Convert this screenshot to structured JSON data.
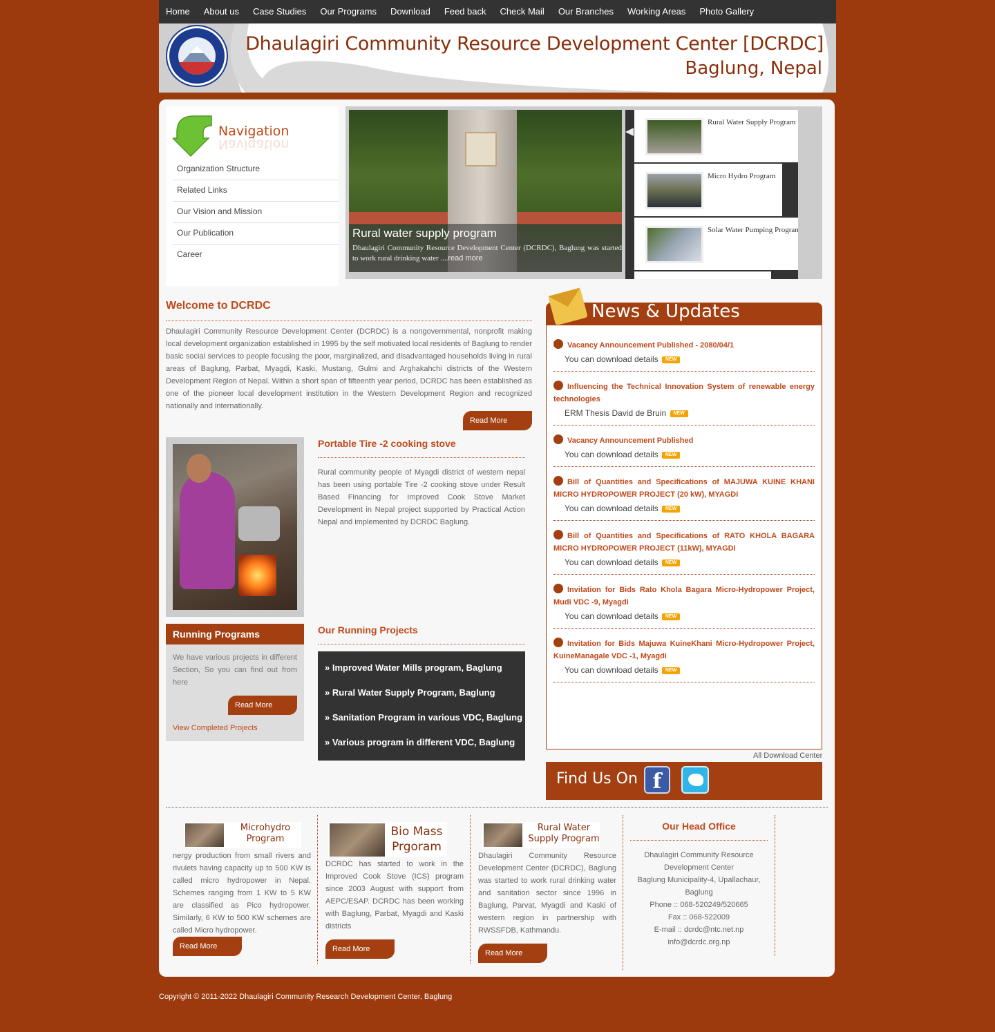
{
  "topnav": [
    "Home",
    "About us",
    "Case Studies",
    "Our Programs",
    "Download",
    "Feed back",
    "Check Mail",
    "Our Branches",
    "Working Areas",
    "Photo Gallery"
  ],
  "banner": {
    "title_line1": "Dhaulagiri Community Resource Development Center [DCRDC]",
    "title_line2": "Baglung, Nepal"
  },
  "navigation": {
    "heading": "Navigation",
    "items": [
      "Organization Structure",
      "Related Links",
      "Our Vision and Mission",
      "Our Publication",
      "Career"
    ]
  },
  "slider": {
    "main_title": "Rural water supply program",
    "main_text": "Dhaulagiri Community Resource Development Center (DCRDC), Baglung was started to work rural drinking water ....",
    "read_more": "read more",
    "thumbs": [
      "Rural Water Supply Program",
      "Micro Hydro Program",
      "Solar Water Pumping Program"
    ]
  },
  "welcome": {
    "title": "Welcome to DCRDC",
    "text": "Dhaulagiri Community Resource Development Center (DCRDC) is a nongovernmental, nonprofit making local development organization established in 1995 by the self motivated local residents of Baglung to render basic social services to people focusing the poor, marginalized, and disadvantaged households living in rural areas of Baglung, Parbat, Myagdi, Kaski, Mustang, Gulmi and Arghakahchi districts of the Western Development Region of Nepal. Within a short span of fifteenth year period, DCRDC has been established as one of the pioneer local development institution in the Western Development Region and recognized nationally and internationally.",
    "read_more": "Read More"
  },
  "stove": {
    "title": "Portable Tire -2 cooking stove",
    "text": "Rural community people of Myagdi district of western nepal has been using portable Tire -2 cooking stove under Result Based Financing for Improved Cook Stove Market Development in Nepal project supported by Practical Action Nepal and implemented by DCRDC Baglung."
  },
  "running": {
    "title": "Running Programs",
    "text": "We have various projects in different Section, So you can find out from here",
    "read_more": "Read More",
    "completed_link": "View Completed Projects"
  },
  "projects": {
    "title": "Our Running Projects",
    "items": [
      "» Improved Water Mills program, Baglung",
      "» Rural Water Supply Program, Baglung",
      "» Sanitation Program in various VDC, Baglung",
      "» Various program in different VDC, Baglung"
    ]
  },
  "news": {
    "title": "News & Updates",
    "new_badge": "NEW",
    "items": [
      {
        "title": "Vacancy Announcement Published - 2080/04/1",
        "link": "You can download details"
      },
      {
        "title": "Influencing the Technical Innovation System of renewable energy technologies",
        "link": "ERM Thesis David de Bruin"
      },
      {
        "title": "Vacancy Announcement Published",
        "link": "You can download details"
      },
      {
        "title": "Bill of Quantities and Specifications of MAJUWA KUINE KHANI MICRO HYDROPOWER PROJECT (20 kW), MYAGDI",
        "link": "You can download details"
      },
      {
        "title": "Bill of Quantities and Specifications of RATO KHOLA BAGARA MICRO HYDROPOWER PROJECT (11kW), MYAGDI",
        "link": "You can download details"
      },
      {
        "title": "Invitation for Bids Rato Khola Bagara Micro-Hydropower Project, Mudi VDC -9, Myagdi",
        "link": "You can download details"
      },
      {
        "title": "Invitation for Bids Majuwa KuineKhani Micro-Hydropower Project, KuineManagale VDC -1, Myagdi",
        "link": "You can download details"
      }
    ],
    "all_downloads": "All Download Center"
  },
  "findus": {
    "title": "Find Us On",
    "facebook": "f"
  },
  "bottom": {
    "microhydro": {
      "banner": "Microhydro Program",
      "text": "nergy production from small rivers and rivulets having capacity up to 500 KW is called micro hydropower in Nepal. Schemes ranging from 1 KW to 5 KW are classified as Pico hydropower. Similarly, 6 KW to 500 KW schemes are called Micro hydropower.",
      "read_more": "Read More"
    },
    "biomass": {
      "banner": "Bio Mass Prgoram",
      "text": "DCRDC has started to work in the Improved Cook Stove (ICS) program since 2003 August with support from AEPC/ESAP. DCRDC has been working with Baglung, Parbat, Myagdi and Kaski districts",
      "read_more": "Read More"
    },
    "water": {
      "banner": "Rural Water Supply Program",
      "text": "Dhaulagiri Community Resource Development Center (DCRDC), Baglung was started to work rural drinking water and sanitation sector since 1996 in Baglung, Parvat, Myagdi and Kaski of western region in partnership with RWSSFDB, Kathmandu.",
      "read_more": "Read More"
    },
    "office": {
      "title": "Our Head Office",
      "lines": [
        "Dhaulagiri Community Resource Development Center",
        "Baglung Municipality-4, Upallachaur, Baglung",
        "Phone :: 068-520249/520665",
        "Fax :: 068-522009",
        "E-mail :: dcrdc@ntc.net.np",
        "info@dcrdc.org.np"
      ]
    }
  },
  "copyright": "Copyright © 2011-2022 Dhaulagiri Community Research Development Center, Baglung"
}
